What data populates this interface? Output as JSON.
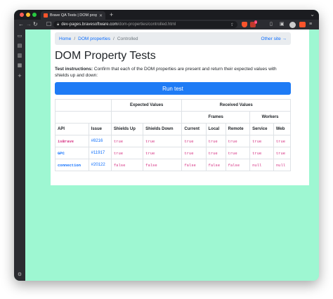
{
  "browser": {
    "tab_title": "Brave QA Tests | DOM properti...",
    "url_domain": "dev-pages.bravesoftware.com",
    "url_path": "/dom-properties/controlled.html",
    "rewards_badge": "1"
  },
  "breadcrumb": {
    "home": "Home",
    "section": "DOM properties",
    "current": "Controlled",
    "other_site": "Other site →"
  },
  "page": {
    "title": "DOM Property Tests",
    "instructions_label": "Test instructions:",
    "instructions_text": " Confirm that each of the DOM properties are present and return their expected values with shields up and down:",
    "run_button": "Run test"
  },
  "table": {
    "group_expected": "Expected Values",
    "group_received": "Received Values",
    "group_frames": "Frames",
    "group_workers": "Workers",
    "columns": [
      "API",
      "Issue",
      "Shields Up",
      "Shields Down",
      "Current",
      "Local",
      "Remote",
      "Service",
      "Web"
    ],
    "rows": [
      {
        "api": "isBrave",
        "issue": "#8216",
        "values": [
          "true",
          "true",
          "true",
          "true",
          "true",
          "true",
          "true"
        ]
      },
      {
        "api": "GPC",
        "issue": "#11917",
        "values": [
          "true",
          "true",
          "true",
          "true",
          "true",
          "true",
          "true"
        ]
      },
      {
        "api": "connection",
        "issue": "#20122",
        "values": [
          "false",
          "false",
          "false",
          "false",
          "false",
          "null",
          "null"
        ]
      }
    ]
  },
  "colors": {
    "page_background": "#9ef7d2",
    "accent": "#1e7bf5",
    "code": "#d63384"
  }
}
